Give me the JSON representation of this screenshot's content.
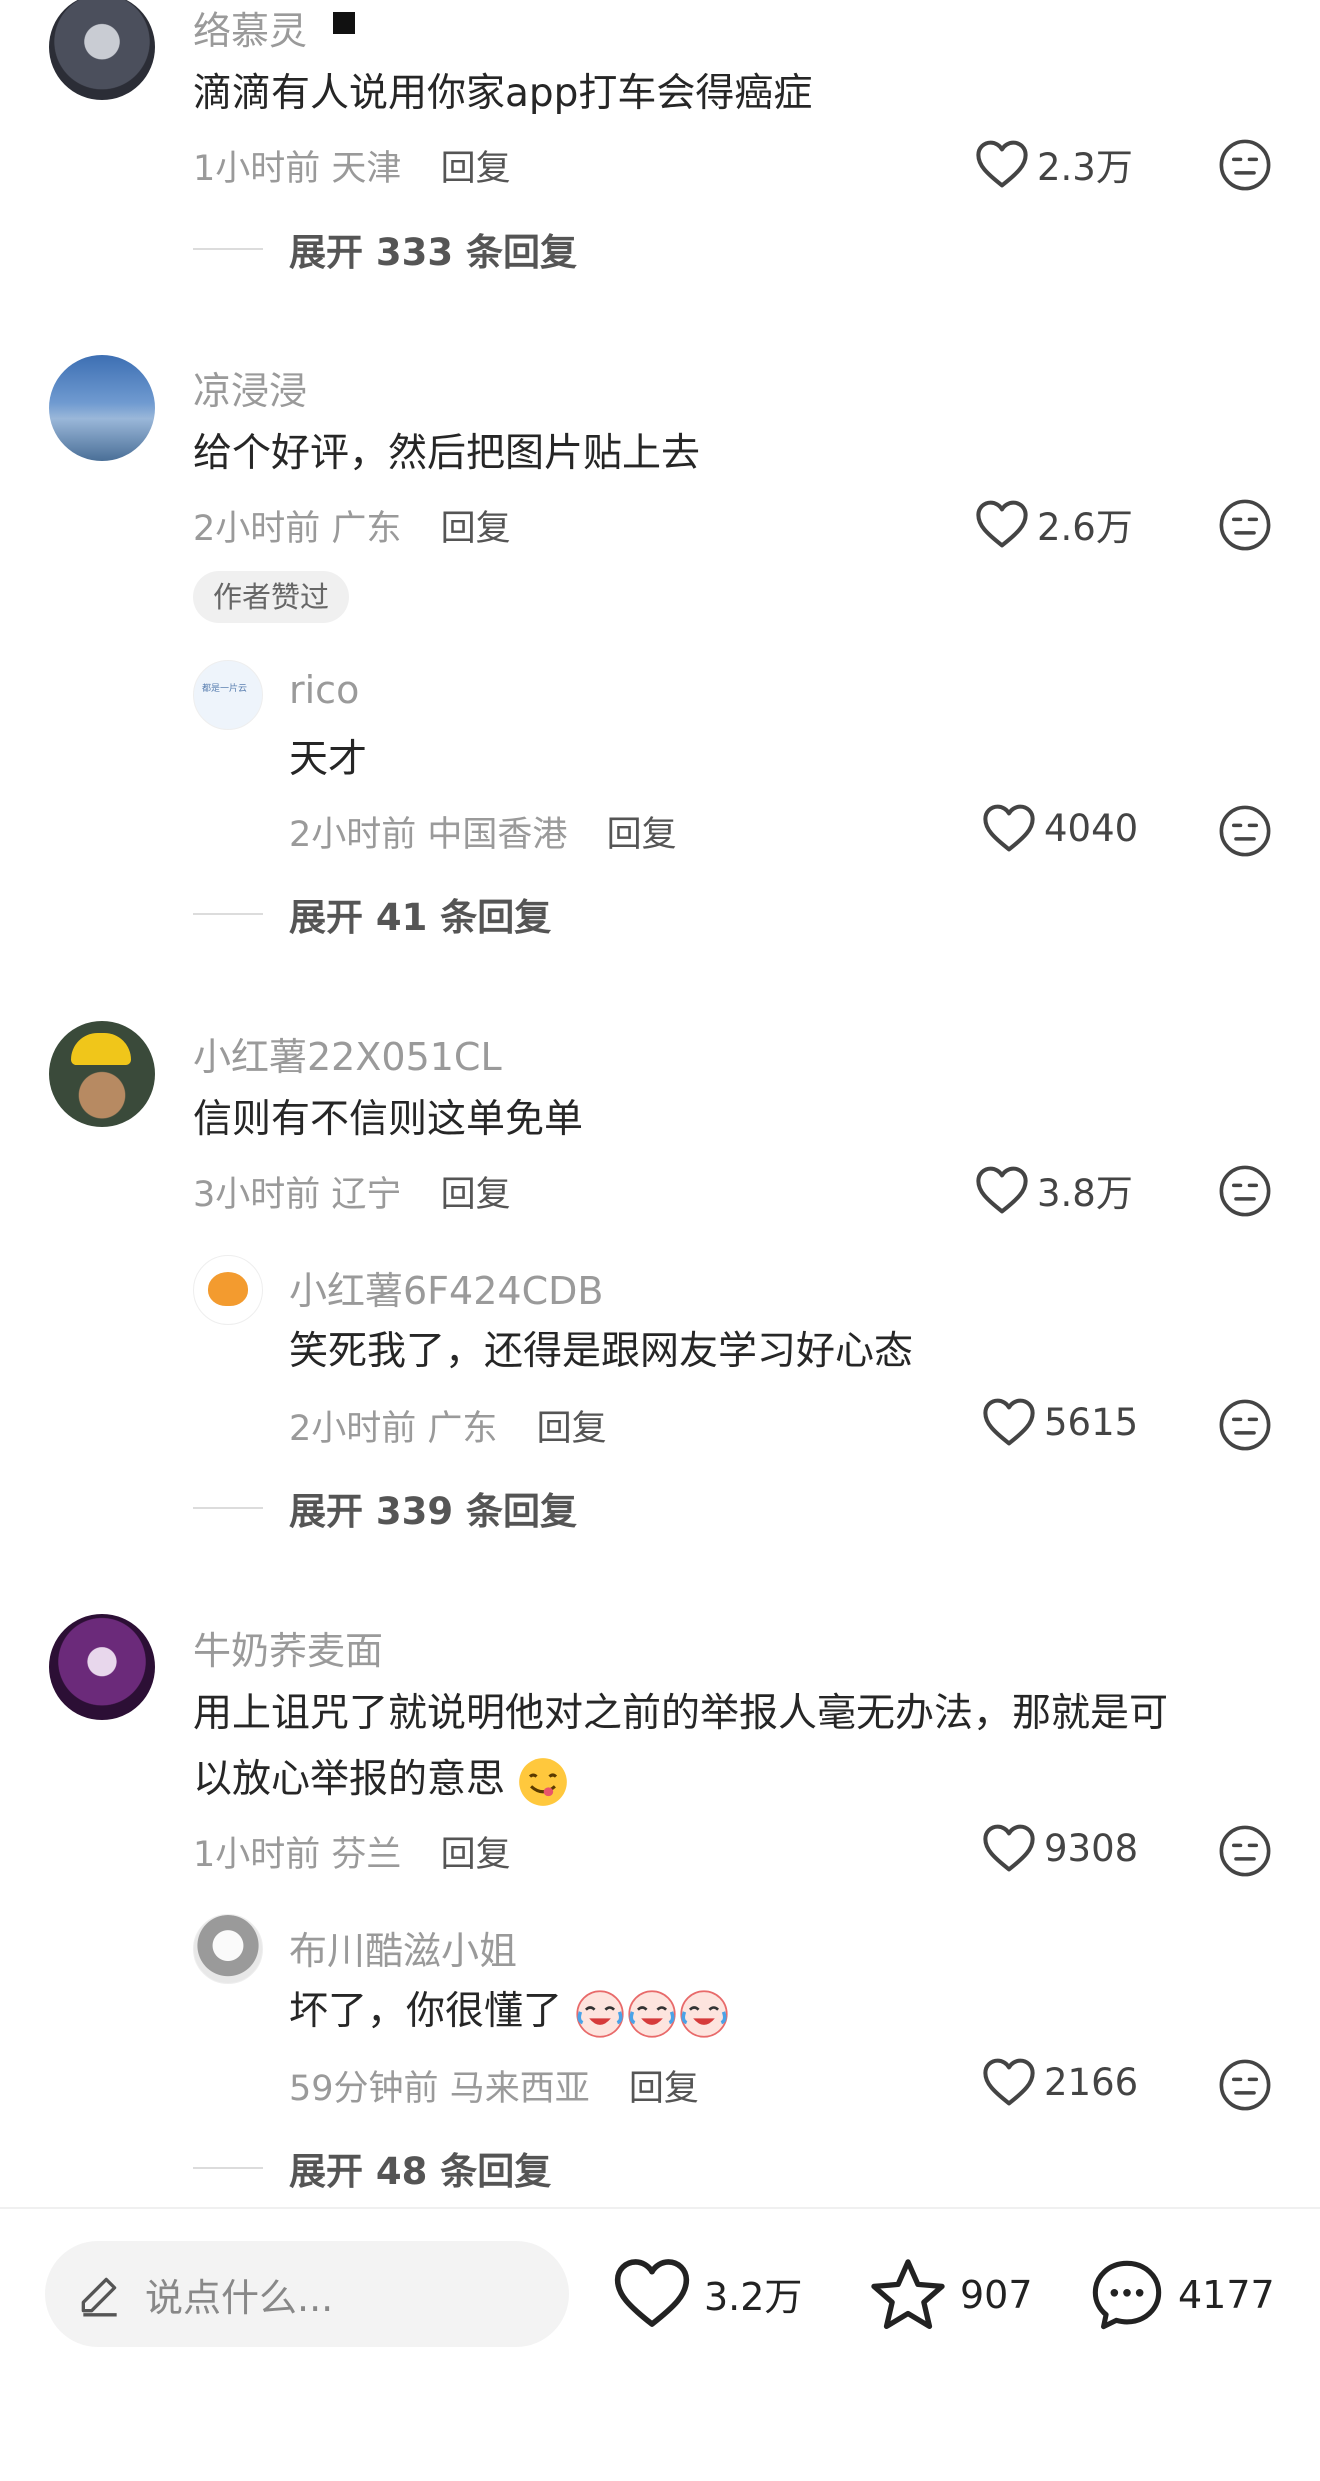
{
  "comments": [
    {
      "user": "络慕灵",
      "text": "滴滴有人说用你家app打车会得癌症",
      "time": "1小时前",
      "location": "天津",
      "reply_label": "回复",
      "likes": "2.3万",
      "expand": "展开 333 条回复"
    },
    {
      "user": "凉浸浸",
      "text": "给个好评，然后把图片贴上去",
      "time": "2小时前",
      "location": "广东",
      "reply_label": "回复",
      "likes": "2.6万",
      "badge": "作者赞过",
      "sub": {
        "user": "rico",
        "avatar_text": "都是一片云",
        "text": "天才",
        "time": "2小时前",
        "location": "中国香港",
        "reply_label": "回复",
        "likes": "4040"
      },
      "expand": "展开 41 条回复"
    },
    {
      "user": "小红薯22X051CL",
      "text": "信则有不信则这单免单",
      "time": "3小时前",
      "location": "辽宁",
      "reply_label": "回复",
      "likes": "3.8万",
      "sub": {
        "user": "小红薯6F424CDB",
        "text": "笑死我了，还得是跟网友学习好心态",
        "time": "2小时前",
        "location": "广东",
        "reply_label": "回复",
        "likes": "5615"
      },
      "expand": "展开 339 条回复"
    },
    {
      "user": "牛奶荞麦面",
      "text_line1": "用上诅咒了就说明他对之前的举报人毫无办法，那就是可",
      "text_line2": "以放心举报的意思",
      "time": "1小时前",
      "location": "芬兰",
      "reply_label": "回复",
      "likes": "9308",
      "sub": {
        "user": "布川酷滋小姐",
        "text": "坏了，你很懂了",
        "time": "59分钟前",
        "location": "马来西亚",
        "reply_label": "回复",
        "likes": "2166"
      },
      "expand": "展开 48 条回复"
    }
  ],
  "bottom_bar": {
    "input_placeholder": "说点什么...",
    "likes": "3.2万",
    "stars": "907",
    "comments": "4177"
  },
  "icons": {
    "like": "heart-outline-icon",
    "dislike": "meh-face-icon",
    "edit": "pencil-icon",
    "star": "star-outline-icon",
    "comment": "chat-bubble-icon"
  },
  "colors": {
    "muted_text": "#9a9a9a",
    "main_text": "#262626",
    "badge_bg": "#f0f0f0"
  }
}
